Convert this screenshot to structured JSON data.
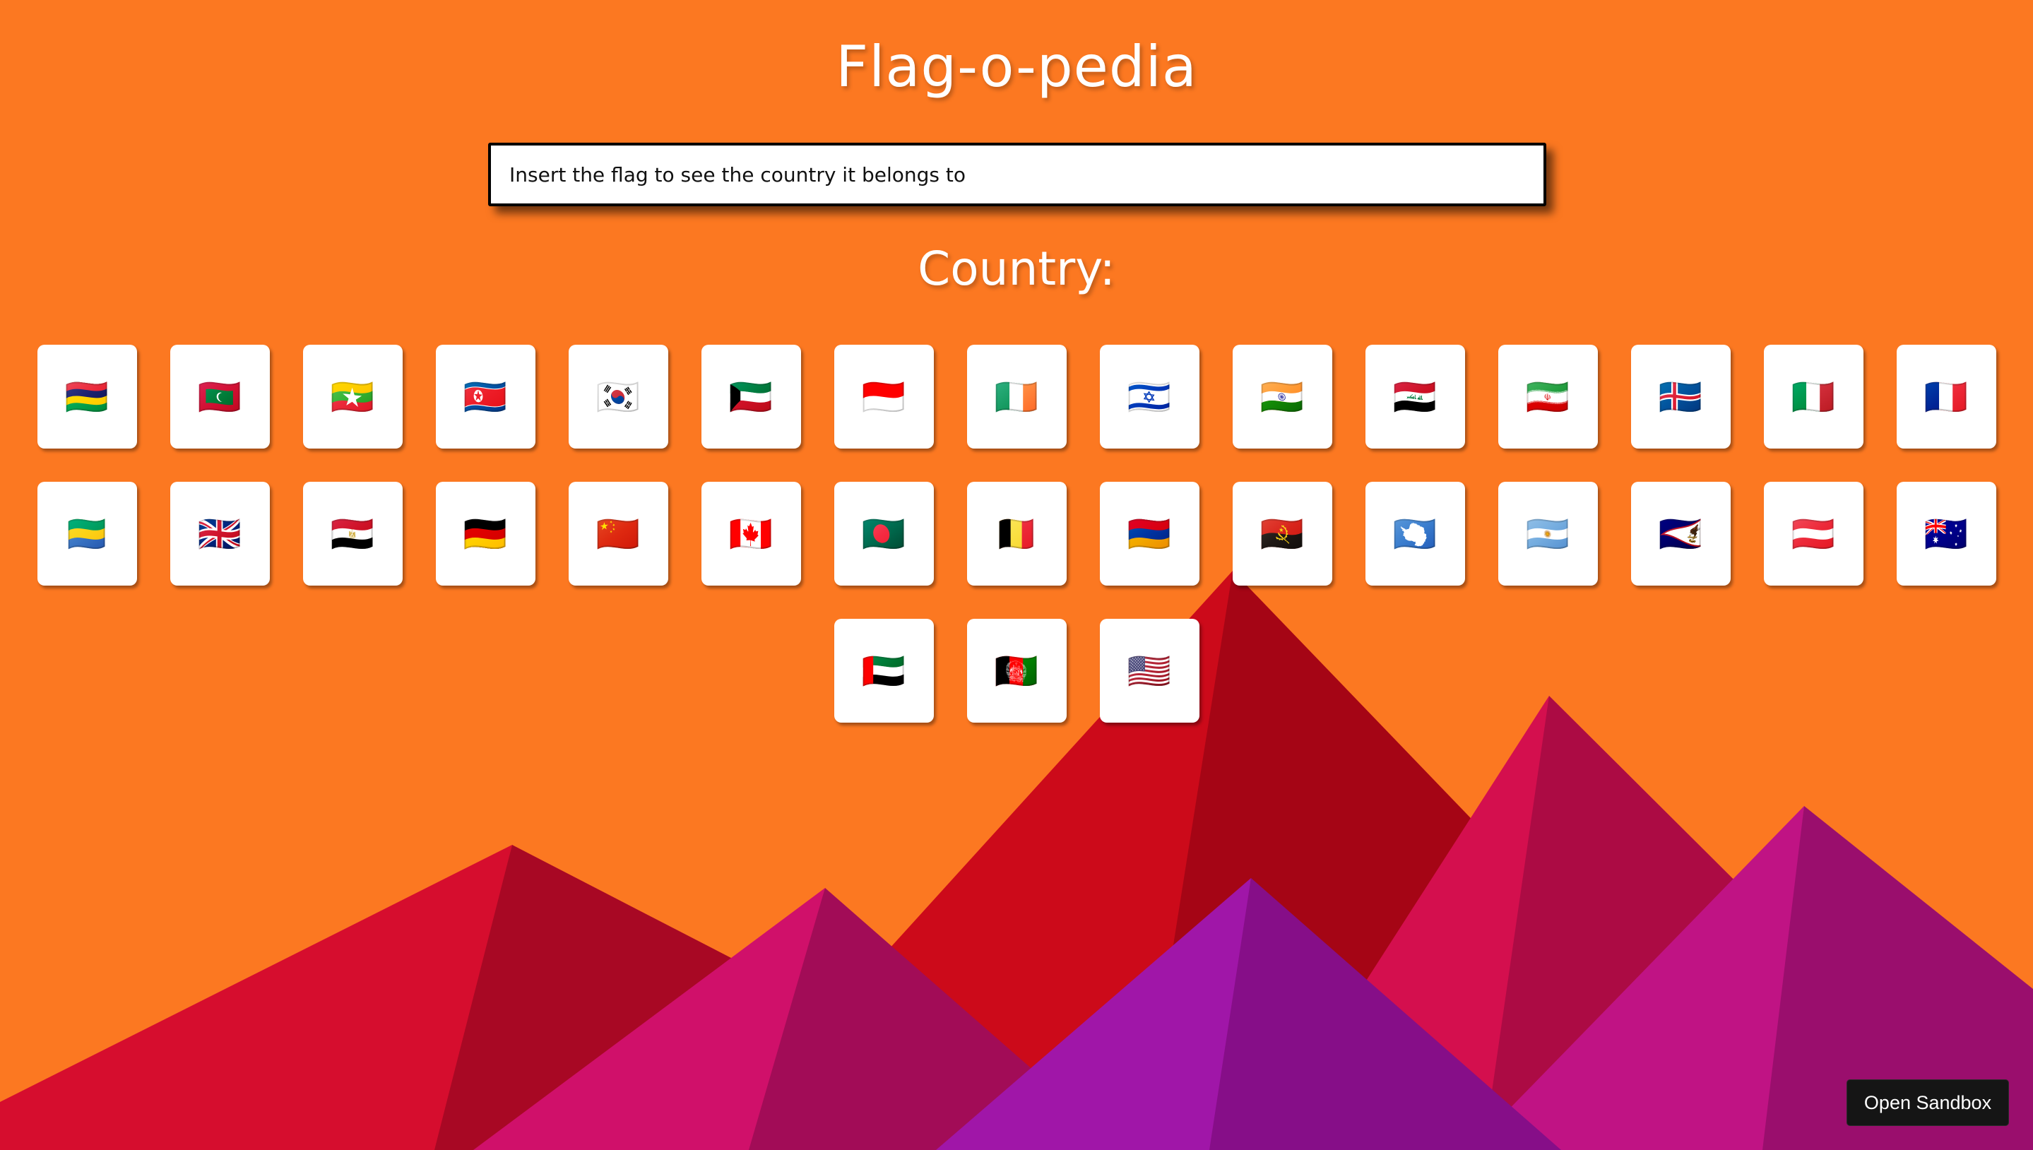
{
  "app": {
    "title": "Flag-o-pedia",
    "subtitle": "Country:"
  },
  "search": {
    "placeholder": "Insert the flag to see the country it belongs to",
    "value": ""
  },
  "flags": [
    [
      "🇲🇺",
      "🇲🇻",
      "🇲🇲",
      "🇰🇵",
      "🇰🇷",
      "🇰🇼",
      "🇮🇩",
      "🇮🇪",
      "🇮🇱",
      "🇮🇳",
      "🇮🇶",
      "🇮🇷",
      "🇮🇸",
      "🇮🇹",
      "🇫🇷"
    ],
    [
      "🇬🇦",
      "🇬🇧",
      "🇪🇬",
      "🇩🇪",
      "🇨🇳",
      "🇨🇦",
      "🇧🇩",
      "🇧🇪",
      "🇦🇲",
      "🇦🇴",
      "🇦🇶",
      "🇦🇷",
      "🇦🇸",
      "🇦🇹",
      "🇦🇺"
    ],
    [
      "🇦🇪",
      "🇦🇫",
      "🇺🇸"
    ]
  ],
  "sandbox_button": {
    "label": "Open Sandbox"
  },
  "colors": {
    "background": "#fc7821",
    "mountain_red": "#d70f2e",
    "mountain_dark_red": "#a80820",
    "mountain_pink": "#d0106a",
    "mountain_dark_pink": "#a20c56",
    "mountain_purple": "#9f16a6",
    "mountain_dark_purple": "#870e88"
  }
}
